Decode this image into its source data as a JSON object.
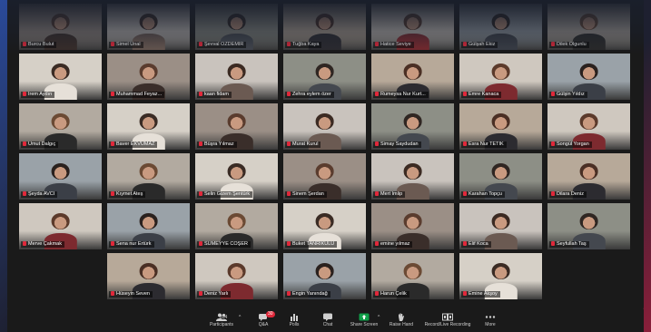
{
  "participants_grid": [
    {
      "name": "Burcu Bulut"
    },
    {
      "name": "Simel Ünal"
    },
    {
      "name": "Şevval ÖZDEMİR"
    },
    {
      "name": "Tuğba Kaya"
    },
    {
      "name": "Hatice Seviye"
    },
    {
      "name": "Gülşah Ekiz"
    },
    {
      "name": "Dilek Olgunlu"
    },
    {
      "name": "İrem Aydın"
    },
    {
      "name": "Muhammad Feyaz..."
    },
    {
      "name": "kaan fidam"
    },
    {
      "name": "Zehra eylem özer"
    },
    {
      "name": "Rumeysa Nur Kurt..."
    },
    {
      "name": "Emre Kanaca"
    },
    {
      "name": "Gülşin Yıldız"
    },
    {
      "name": "Umut Dalgıç"
    },
    {
      "name": "Baver EKVUMAZ"
    },
    {
      "name": "Büşra Yılmaz"
    },
    {
      "name": "Murat Kurul"
    },
    {
      "name": "Simay Saydudan"
    },
    {
      "name": "Esra Nur TETİK"
    },
    {
      "name": "Songül Yorgan"
    },
    {
      "name": "Şeyda AVCI"
    },
    {
      "name": "Kıymet Ateş"
    },
    {
      "name": "Selin Gizem Şentürk"
    },
    {
      "name": "Sinem Şerdan"
    },
    {
      "name": "Mert İmlip"
    },
    {
      "name": "Karahan Topçu"
    },
    {
      "name": "Dilara Deniz"
    },
    {
      "name": "Merve Çakmak"
    },
    {
      "name": "Sena nur Ertürk"
    },
    {
      "name": "SÜMEYYE COŞER"
    },
    {
      "name": "Buket TANRIKULU"
    },
    {
      "name": "emine yılmaz"
    },
    {
      "name": "Elif Koca"
    },
    {
      "name": "Seyfullah Taş"
    },
    {
      "name": "Hüseyin Seven"
    },
    {
      "name": "Deniz Yarlı"
    },
    {
      "name": "Engin Yanındağ"
    },
    {
      "name": "Harun Çelik"
    },
    {
      "name": "Emine Akşoy"
    }
  ],
  "toolbar": {
    "participants_label": "Participants",
    "participants_count": "334",
    "chat_badge": "30",
    "qa_label": "Q&A",
    "polls_label": "Polls",
    "chat_label": "Chat",
    "share_label": "Share Screen",
    "raise_hand_label": "Raise Hand",
    "recording_label": "Record/Live Recording",
    "more_label": "More"
  },
  "colors": {
    "mic_muted": "#e0283a",
    "share_green": "#0e9f48",
    "frame_blue": "#2a4a9a",
    "frame_red": "#8a1f3a"
  }
}
